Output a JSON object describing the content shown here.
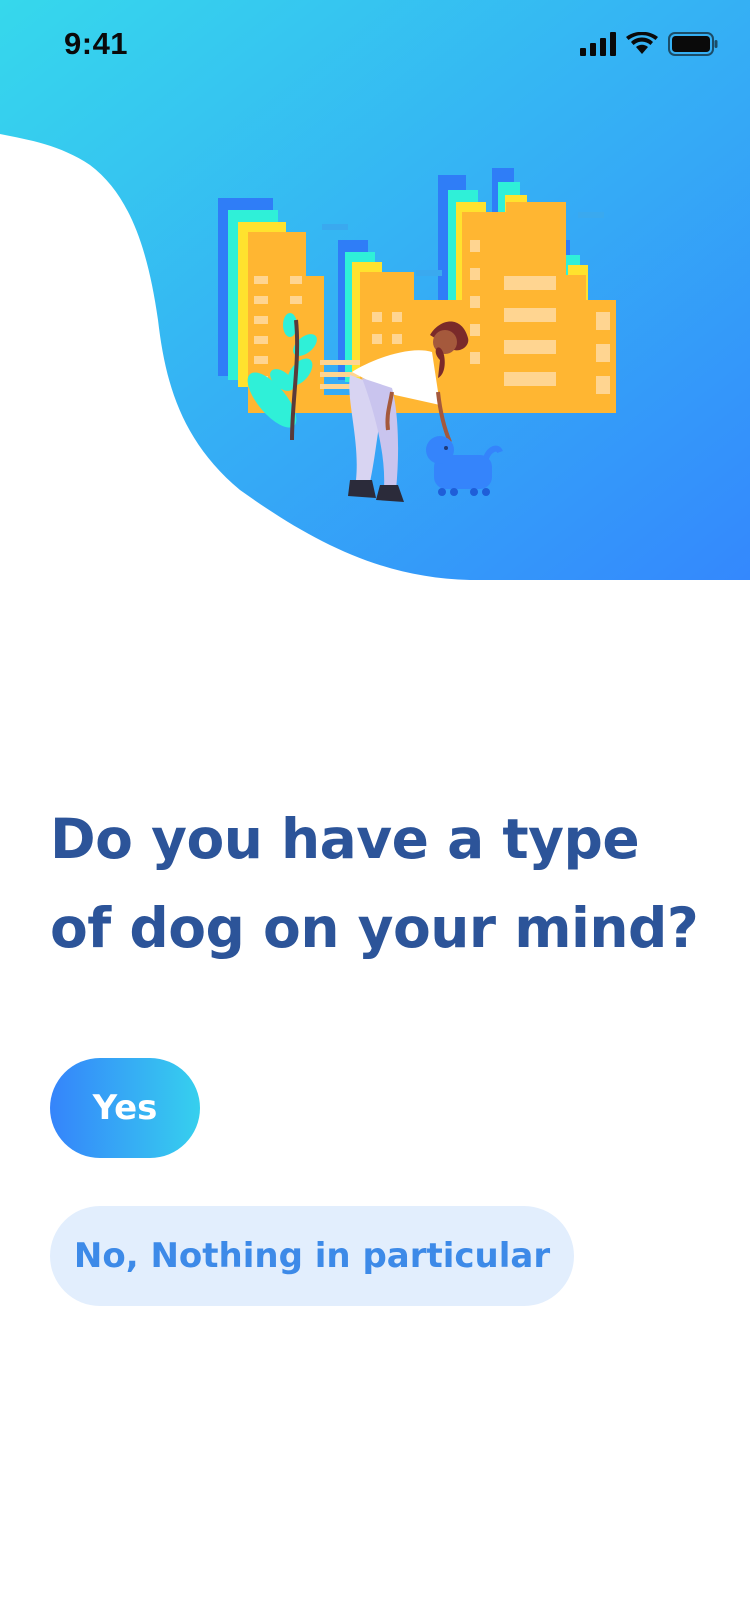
{
  "status_bar": {
    "time": "9:41",
    "icons": [
      "signal-icon",
      "wifi-icon",
      "battery-icon"
    ]
  },
  "hero": {
    "illustration": "woman-walking-dog-city-illustration"
  },
  "question": {
    "text": "Do you have a type of dog on your mind?"
  },
  "answers": {
    "yes_label": "Yes",
    "no_label": "No, Nothing in particular"
  },
  "colors": {
    "hero_gradient_start": "#36d8ec",
    "hero_gradient_end": "#3488fd",
    "heading": "#2c5499",
    "primary_button_start": "#3584fb",
    "primary_button_end": "#36d0ee",
    "secondary_button_bg": "#e2eefd",
    "secondary_button_text": "#3d8ae8"
  }
}
